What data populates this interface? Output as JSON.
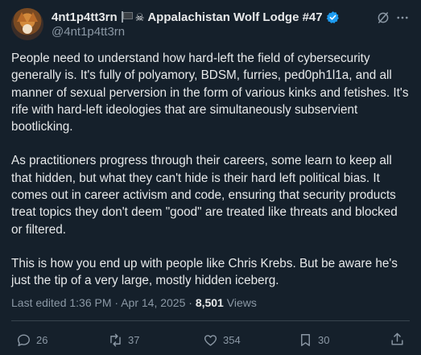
{
  "author": {
    "display_name": "4nt1p4tt3rn",
    "lodge": "Appalachistan Wolf Lodge #47",
    "handle": "@4nt1p4tt3rn"
  },
  "post": {
    "paragraphs": [
      "People need to understand how hard-left the field of cybersecurity generally is. It's fully of polyamory, BDSM, furries, ped0ph1l1a, and all manner of sexual perversion in the form of various kinks and fetishes. It's rife with hard-left ideologies that are simultaneously subservient bootlicking.",
      "As practitioners progress through their careers, some learn to keep all that hidden, but what they can't hide is their hard left political bias. It comes out in career activism and code, ensuring that security products treat topics they don't deem \"good\" are treated like threats and blocked or filtered.",
      "This is how you end up with people like Chris Krebs. But be aware he's just the tip of a very large, mostly hidden iceberg."
    ],
    "edited_label": "Last edited 1:36 PM · Apr 14, 2025 · ",
    "views_count": "8,501",
    "views_label": " Views"
  },
  "stats": {
    "replies": "26",
    "reposts": "37",
    "likes": "354",
    "bookmarks": "30"
  },
  "colors": {
    "background": "#15202b",
    "text": "#e7e9ea",
    "muted": "#8b98a5",
    "verified": "#1d9bf0",
    "divider": "#38444d"
  },
  "icons": [
    "flag-icon",
    "skull-crossbones-icon",
    "verified-badge-icon",
    "grok-icon",
    "more-icon",
    "reply-icon",
    "repost-icon",
    "like-icon",
    "bookmark-icon",
    "share-icon"
  ]
}
